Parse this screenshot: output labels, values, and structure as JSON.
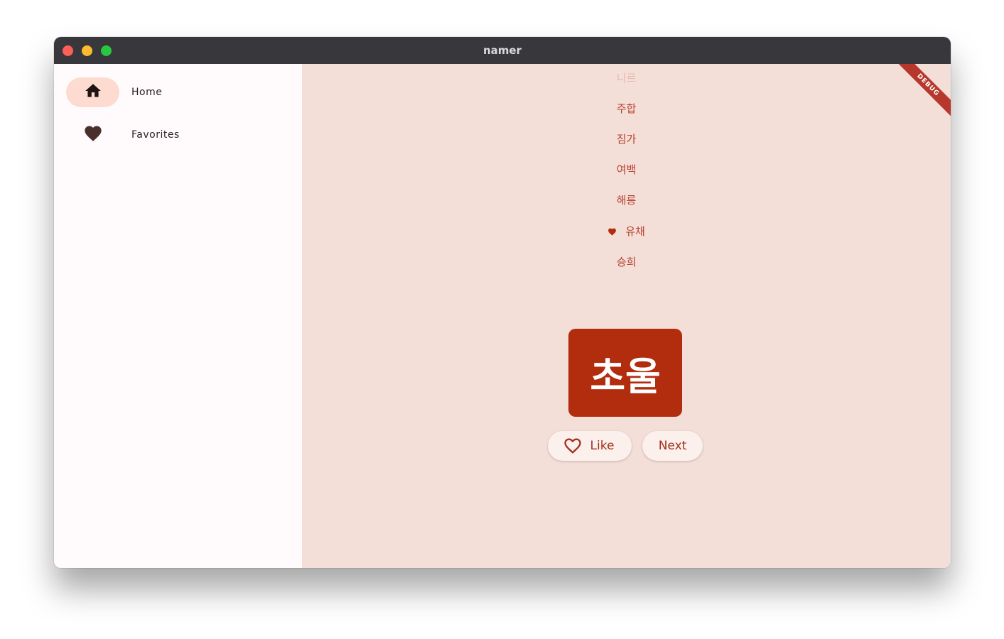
{
  "window": {
    "title": "namer"
  },
  "sidebar": {
    "items": [
      {
        "label": "Home",
        "icon": "home-icon",
        "selected": true
      },
      {
        "label": "Favorites",
        "icon": "heart-icon",
        "selected": false
      }
    ]
  },
  "main": {
    "history": [
      {
        "word": "니르",
        "favorite": false,
        "faded": true
      },
      {
        "word": "주합",
        "favorite": false,
        "faded": false
      },
      {
        "word": "짐가",
        "favorite": false,
        "faded": false
      },
      {
        "word": "여백",
        "favorite": false,
        "faded": false
      },
      {
        "word": "해릉",
        "favorite": false,
        "faded": false
      },
      {
        "word": "유채",
        "favorite": true,
        "faded": false
      },
      {
        "word": "승희",
        "favorite": false,
        "faded": false
      }
    ],
    "current_word": "초울",
    "like_label": "Like",
    "next_label": "Next"
  },
  "debug_banner": "DEBUG",
  "colors": {
    "titlebar": "#38373c",
    "sidebar_bg": "#fffbfd",
    "main_bg": "#f4ded8",
    "card": "#b22c0e",
    "accent_text": "#b4412e",
    "selected_indicator": "#fddbd1",
    "button_bg": "#fcf0ed"
  }
}
